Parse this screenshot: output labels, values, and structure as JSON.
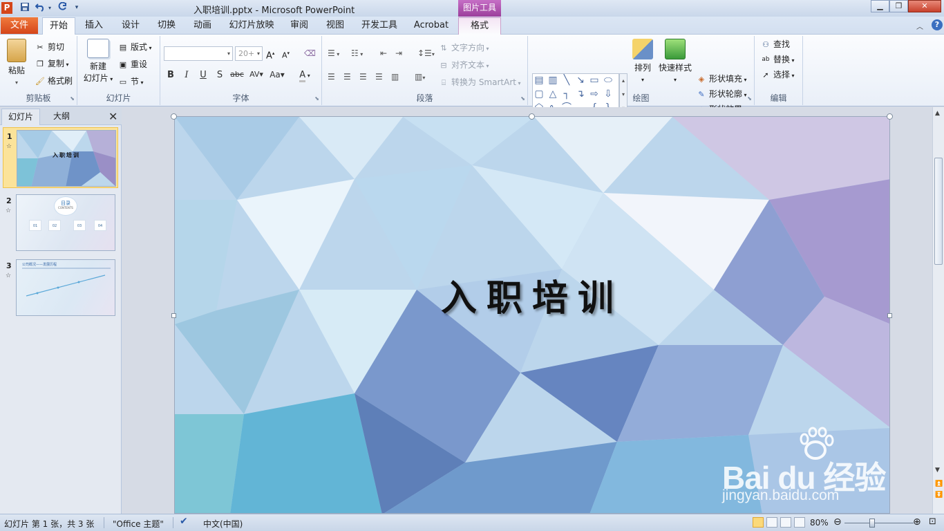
{
  "window": {
    "title": "入职培训.pptx - Microsoft PowerPoint",
    "contextual_tab_group": "图片工具"
  },
  "quick_access": {
    "save_icon": "save-icon",
    "undo_icon": "undo-icon",
    "redo_icon": "redo-icon"
  },
  "tabs": [
    "开始",
    "插入",
    "设计",
    "切换",
    "动画",
    "幻灯片放映",
    "审阅",
    "视图",
    "开发工具",
    "Acrobat",
    "格式"
  ],
  "file_tab": "文件",
  "active_tab": "开始",
  "ribbon": {
    "clipboard": {
      "label": "剪贴板",
      "paste": "粘贴",
      "cut": "剪切",
      "copy": "复制",
      "format_painter": "格式刷"
    },
    "slides": {
      "label": "幻灯片",
      "new_slide_line1": "新建",
      "new_slide_line2": "幻灯片",
      "layout": "版式",
      "reset": "重设",
      "section": "节"
    },
    "font": {
      "label": "字体",
      "font_name": "",
      "font_size": "20+"
    },
    "paragraph": {
      "label": "段落",
      "text_direction": "文字方向",
      "align_text": "对齐文本",
      "convert_smartart": "转换为 SmartArt"
    },
    "drawing": {
      "label": "绘图",
      "arrange": "排列",
      "quick_styles": "快速样式",
      "shape_fill": "形状填充",
      "shape_outline": "形状轮廓",
      "shape_effects": "形状效果"
    },
    "editing": {
      "label": "编辑",
      "find": "查找",
      "replace": "替换",
      "select": "选择"
    }
  },
  "slides_pane": {
    "tab_slides": "幻灯片",
    "tab_outline": "大纲",
    "thumbnails": [
      {
        "number": "1",
        "title": "入职培训",
        "selected": true
      },
      {
        "number": "2",
        "title": "目录",
        "subtitle": "CONTENTS",
        "items": [
          "01",
          "02",
          "03",
          "04"
        ]
      },
      {
        "number": "3",
        "title": "公司概况——发展历程"
      }
    ]
  },
  "slide": {
    "title": "入职培训"
  },
  "watermark": {
    "logo_text": "Bai du 经验",
    "url": "jingyan.baidu.com"
  },
  "status_bar": {
    "slide_info": "幻灯片 第 1 张，共 3 张",
    "theme": "\"Office 主题\"",
    "language": "中文(中国)",
    "zoom": "80%"
  },
  "colors": {
    "file_tab": "#d5461a",
    "picture_tools": "#9b3f9b",
    "accent_blue": "#3b6fc0"
  }
}
